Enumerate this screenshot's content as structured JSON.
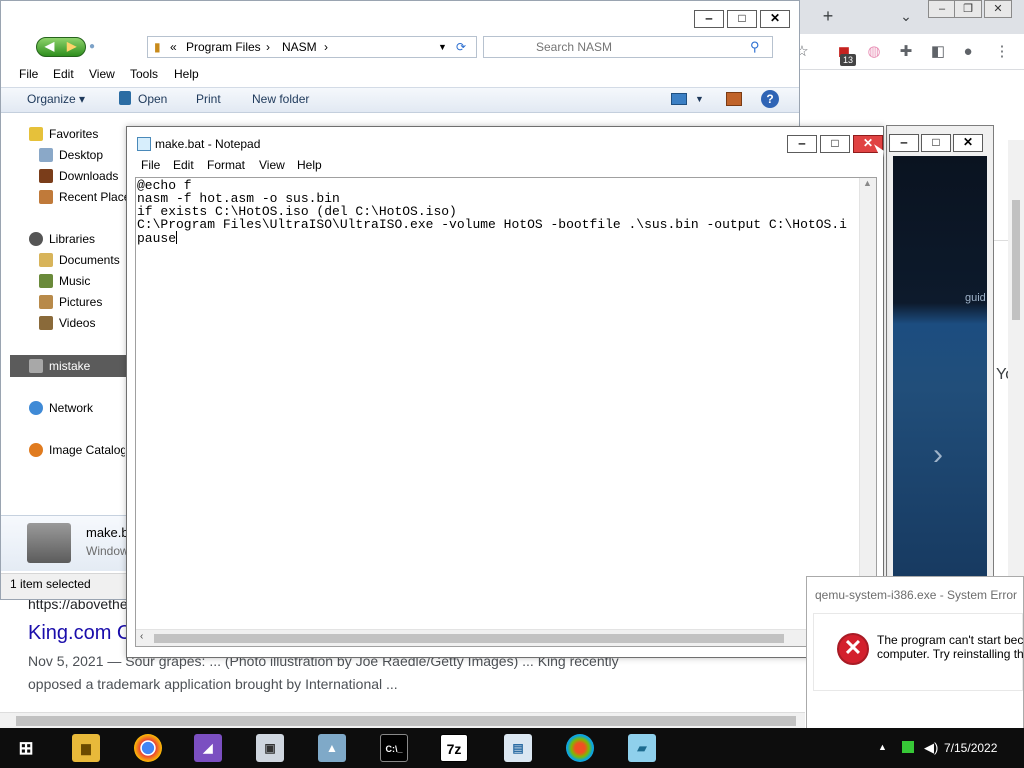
{
  "browser": {
    "new_tab": "+",
    "tab_dropdown": "⌄",
    "ext_badge": "13",
    "result": {
      "url": "https://abovethe",
      "title": "King.com C",
      "snippet_line1": "Nov 5, 2021 — Sour grapes: ... (Photo illustration by Joe Raedle/Getty Images) ... King recently",
      "snippet_line2": "opposed a trademark application brought by International ..."
    },
    "side_text": "Yo",
    "vid_caption": "guid"
  },
  "explorer": {
    "address": {
      "root": "«",
      "parts": [
        "Program Files",
        "NASM"
      ]
    },
    "search_placeholder": "Search NASM",
    "menu": [
      "File",
      "Edit",
      "View",
      "Tools",
      "Help"
    ],
    "commands": [
      "Organize ▾",
      "Open",
      "Print",
      "New folder"
    ],
    "nav": {
      "favorites": "Favorites",
      "favorites_items": [
        "Desktop",
        "Downloads",
        "Recent Places"
      ],
      "libraries": "Libraries",
      "libraries_items": [
        "Documents",
        "Music",
        "Pictures",
        "Videos"
      ],
      "selected": "mistake",
      "network": "Network",
      "image_catalog": "Image Catalog"
    },
    "details": {
      "name": "make.b",
      "type": "Window"
    },
    "status": "1 item selected"
  },
  "notepad": {
    "title": "make.bat - Notepad",
    "menu": [
      "File",
      "Edit",
      "Format",
      "View",
      "Help"
    ],
    "lines": [
      "@echo f",
      "nasm -f hot.asm -o sus.bin",
      "if exists C:\\HotOS.iso (del C:\\HotOS.iso)",
      "C:\\Program Files\\UltraISO\\UltraISO.exe -volume HotOS -bootfile .\\sus.bin -output C:\\HotOS.i",
      "pause"
    ]
  },
  "error_dialog": {
    "title": "qemu-system-i386.exe - System Error",
    "message": "The program can't start bec\ncomputer. Try reinstalling th"
  },
  "taskbar": {
    "clock": "7/15/2022",
    "apps": [
      "Start",
      "File Explorer",
      "Google Chrome",
      "Visual Studio",
      "Remote Desktop",
      "Task Manager",
      "Command Prompt",
      "7-Zip",
      "Application",
      "Windows",
      "Notepad"
    ]
  },
  "colors": {
    "notepad_close": "#e04343",
    "error_icon": "#d3202d",
    "link": "#1a0dab",
    "taskbar": "#0d0d0d"
  }
}
